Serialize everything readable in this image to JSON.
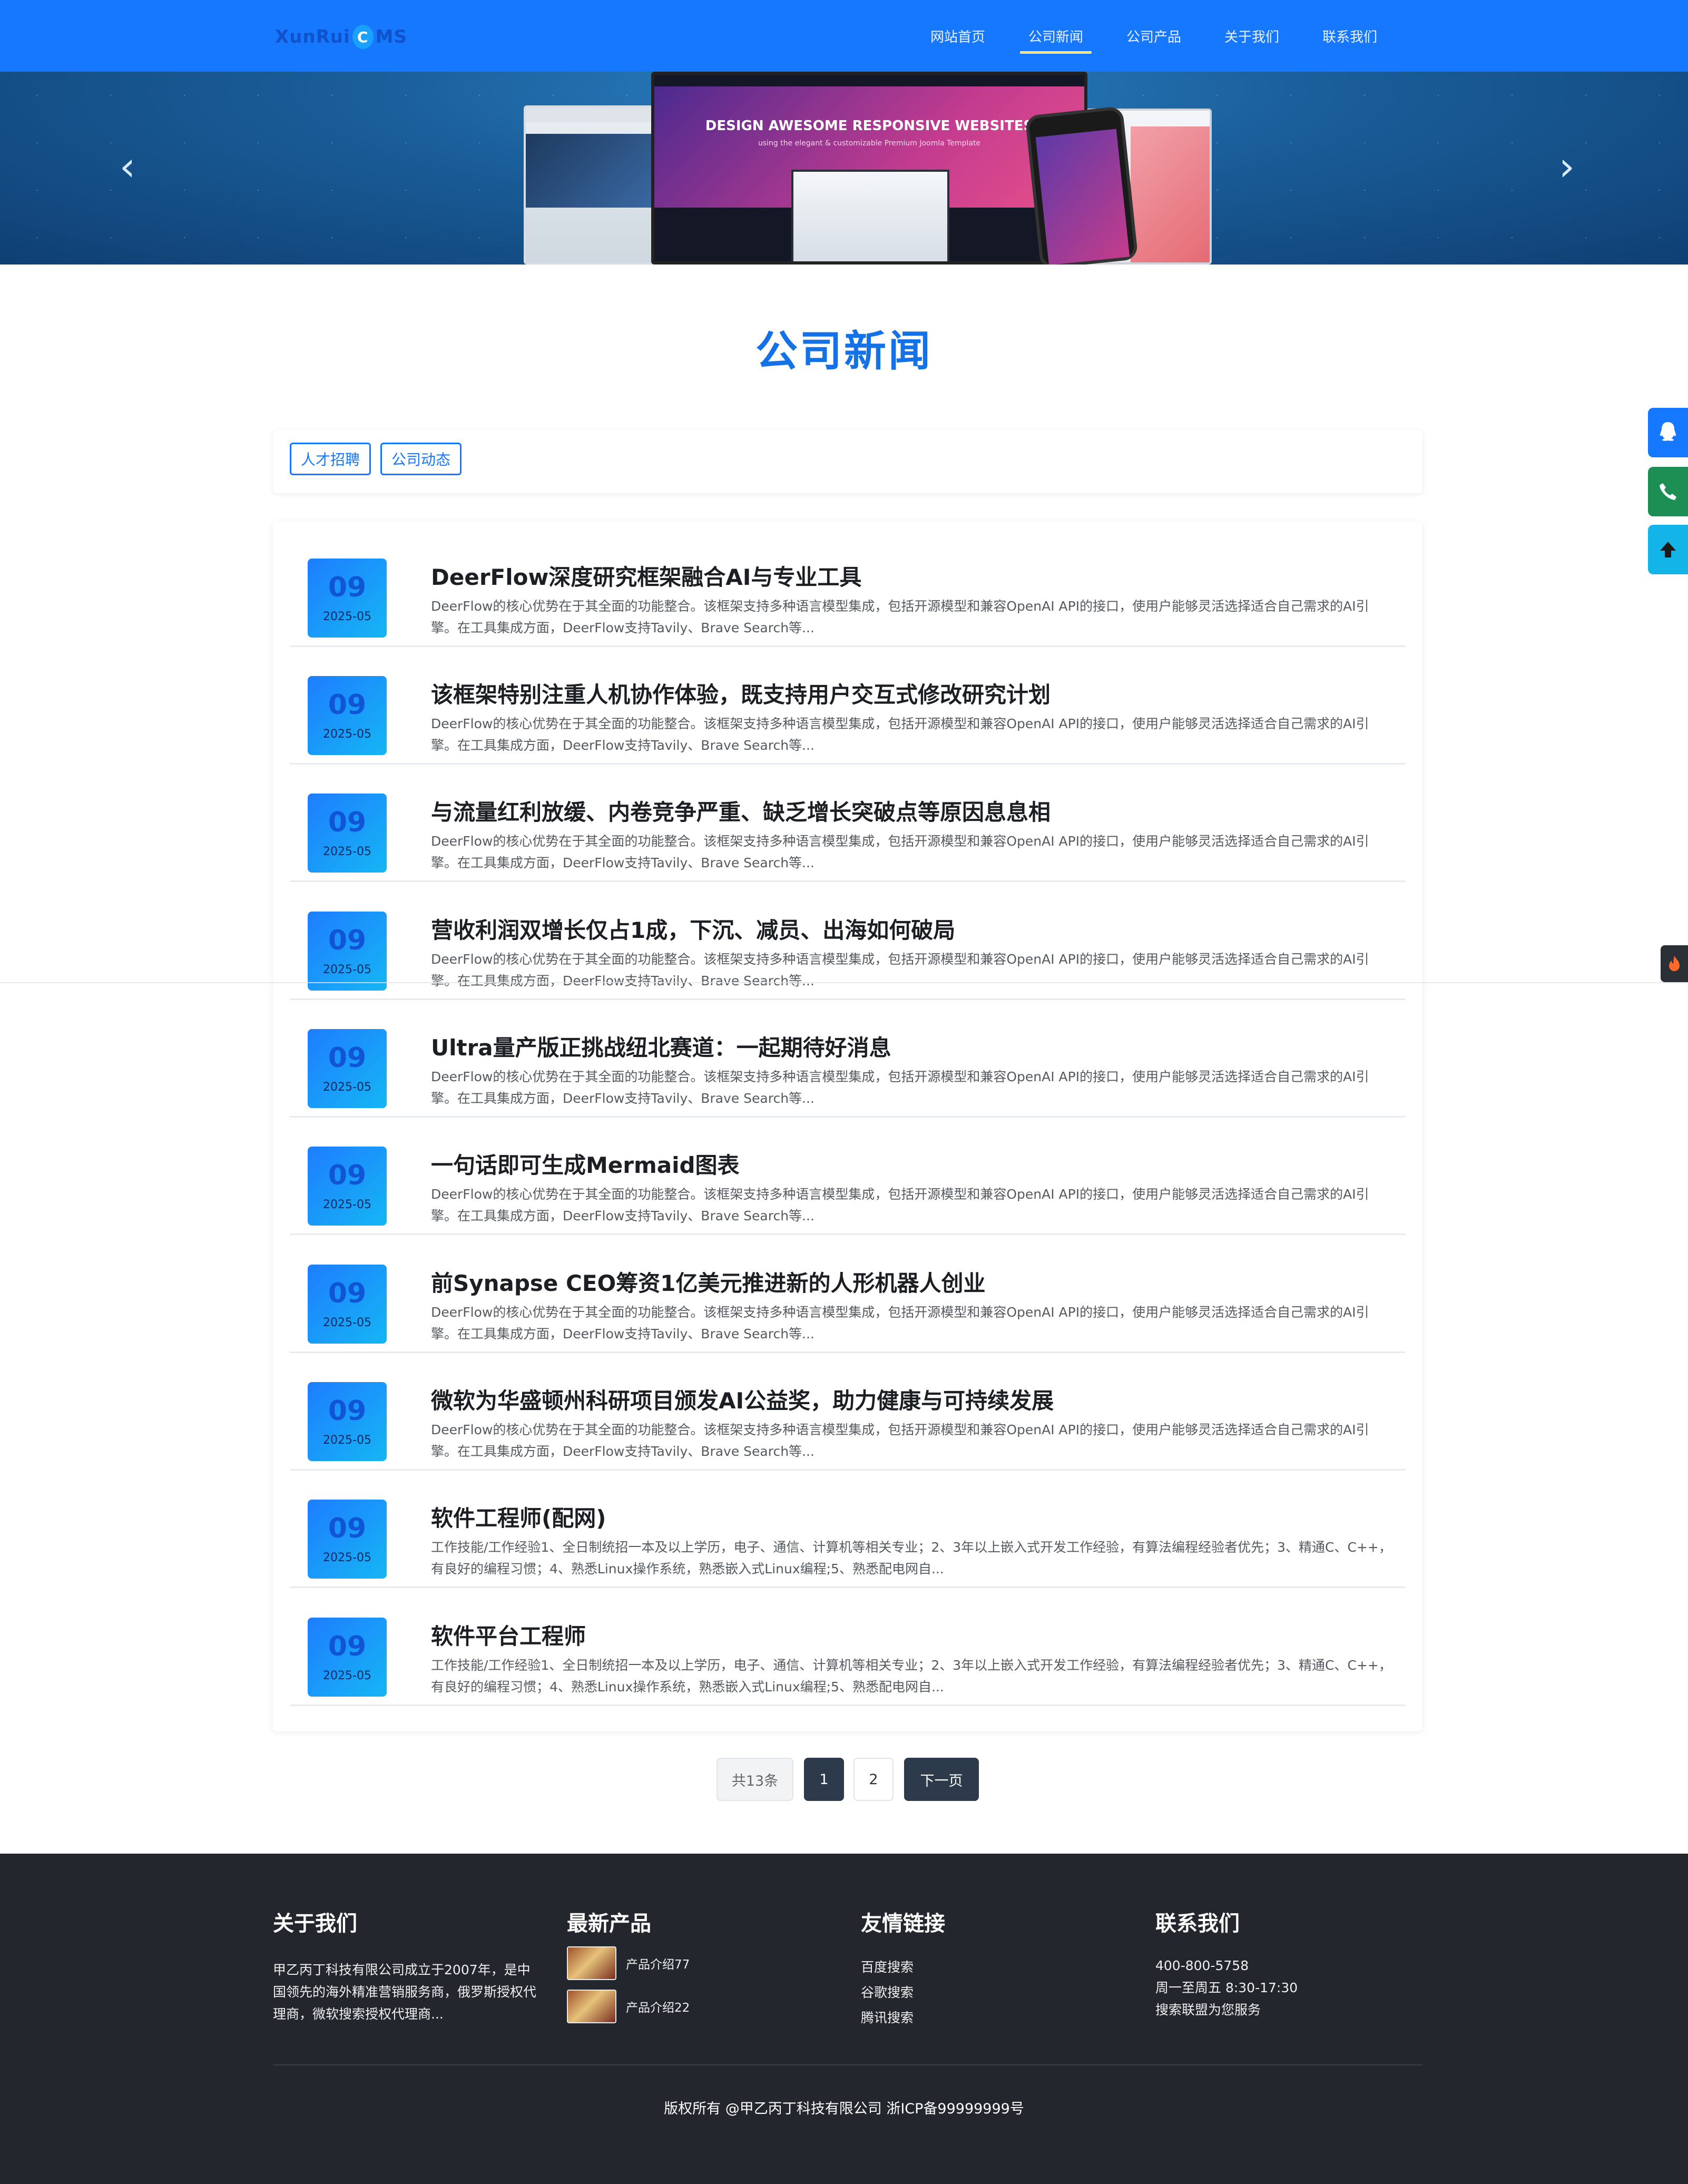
{
  "header": {
    "logo": {
      "text_a": "XunRui",
      "text_c": "C",
      "text_b": "MS"
    },
    "nav": [
      {
        "label": "网站首页",
        "active": false
      },
      {
        "label": "公司新闻",
        "active": true
      },
      {
        "label": "公司产品",
        "active": false
      },
      {
        "label": "关于我们",
        "active": false
      },
      {
        "label": "联系我们",
        "active": false
      }
    ]
  },
  "banner": {
    "prev": "‹",
    "next": "›",
    "mock_title": "DESIGN AWESOME RESPONSIVE WEBSITES",
    "mock_sub": "using the elegant & customizable Premium Joomla Template"
  },
  "page": {
    "title": "公司新闻"
  },
  "categories": [
    "人才招聘",
    "公司动态"
  ],
  "news": [
    {
      "day": "09",
      "ym": "2025-05",
      "title": "DeerFlow深度研究框架融合AI与专业工具",
      "desc": "DeerFlow的核心优势在于其全面的功能整合。该框架支持多种语言模型集成，包括开源模型和兼容OpenAI API的接口，使用户能够灵活选择适合自己需求的AI引擎。在工具集成方面，DeerFlow支持Tavily、Brave Search等..."
    },
    {
      "day": "09",
      "ym": "2025-05",
      "title": "该框架特别注重人机协作体验，既支持用户交互式修改研究计划",
      "desc": "DeerFlow的核心优势在于其全面的功能整合。该框架支持多种语言模型集成，包括开源模型和兼容OpenAI API的接口，使用户能够灵活选择适合自己需求的AI引擎。在工具集成方面，DeerFlow支持Tavily、Brave Search等..."
    },
    {
      "day": "09",
      "ym": "2025-05",
      "title": "与流量红利放缓、内卷竞争严重、缺乏增长突破点等原因息息相",
      "desc": "DeerFlow的核心优势在于其全面的功能整合。该框架支持多种语言模型集成，包括开源模型和兼容OpenAI API的接口，使用户能够灵活选择适合自己需求的AI引擎。在工具集成方面，DeerFlow支持Tavily、Brave Search等..."
    },
    {
      "day": "09",
      "ym": "2025-05",
      "title": "营收利润双增长仅占1成，下沉、减员、出海如何破局",
      "desc": "DeerFlow的核心优势在于其全面的功能整合。该框架支持多种语言模型集成，包括开源模型和兼容OpenAI API的接口，使用户能够灵活选择适合自己需求的AI引擎。在工具集成方面，DeerFlow支持Tavily、Brave Search等..."
    },
    {
      "day": "09",
      "ym": "2025-05",
      "title": "Ultra量产版正挑战纽北赛道：一起期待好消息",
      "desc": "DeerFlow的核心优势在于其全面的功能整合。该框架支持多种语言模型集成，包括开源模型和兼容OpenAI API的接口，使用户能够灵活选择适合自己需求的AI引擎。在工具集成方面，DeerFlow支持Tavily、Brave Search等..."
    },
    {
      "day": "09",
      "ym": "2025-05",
      "title": "一句话即可生成Mermaid图表",
      "desc": "DeerFlow的核心优势在于其全面的功能整合。该框架支持多种语言模型集成，包括开源模型和兼容OpenAI API的接口，使用户能够灵活选择适合自己需求的AI引擎。在工具集成方面，DeerFlow支持Tavily、Brave Search等..."
    },
    {
      "day": "09",
      "ym": "2025-05",
      "title": "前Synapse CEO筹资1亿美元推进新的人形机器人创业",
      "desc": "DeerFlow的核心优势在于其全面的功能整合。该框架支持多种语言模型集成，包括开源模型和兼容OpenAI API的接口，使用户能够灵活选择适合自己需求的AI引擎。在工具集成方面，DeerFlow支持Tavily、Brave Search等..."
    },
    {
      "day": "09",
      "ym": "2025-05",
      "title": "微软为华盛顿州科研项目颁发AI公益奖，助力健康与可持续发展",
      "desc": "DeerFlow的核心优势在于其全面的功能整合。该框架支持多种语言模型集成，包括开源模型和兼容OpenAI API的接口，使用户能够灵活选择适合自己需求的AI引擎。在工具集成方面，DeerFlow支持Tavily、Brave Search等..."
    },
    {
      "day": "09",
      "ym": "2025-05",
      "title": "软件工程师(配网)",
      "desc": "工作技能/工作经验1、全日制统招一本及以上学历，电子、通信、计算机等相关专业；2、3年以上嵌入式开发工作经验，有算法编程经验者优先；3、精通C、C++，有良好的编程习惯；4、熟悉Linux操作系统，熟悉嵌入式Linux编程;5、熟悉配电网自..."
    },
    {
      "day": "09",
      "ym": "2025-05",
      "title": "软件平台工程师",
      "desc": "工作技能/工作经验1、全日制统招一本及以上学历，电子、通信、计算机等相关专业；2、3年以上嵌入式开发工作经验，有算法编程经验者优先；3、精通C、C++，有良好的编程习惯；4、熟悉Linux操作系统，熟悉嵌入式Linux编程;5、熟悉配电网自..."
    }
  ],
  "pagination": {
    "total": "共13条",
    "p1": "1",
    "p2": "2",
    "next": "下一页"
  },
  "footer": {
    "about": {
      "title": "关于我们",
      "text": "甲乙丙丁科技有限公司成立于2007年，是中国领先的海外精准营销服务商，俄罗斯授权代理商，微软搜索授权代理商..."
    },
    "products": {
      "title": "最新产品",
      "items": [
        "产品介绍77",
        "产品介绍22"
      ]
    },
    "links": {
      "title": "友情链接",
      "items": [
        "百度搜索",
        "谷歌搜索",
        "腾讯搜索"
      ]
    },
    "contact": {
      "title": "联系我们",
      "lines": [
        "400-800-5758",
        "周一至周五 8:30-17:30",
        "搜索联盟为您服务"
      ]
    },
    "copyright": "版权所有 @甲乙丙丁科技有限公司 浙ICP备99999999号"
  },
  "widgets": {
    "qq_icon": "qq-icon",
    "phone_icon": "phone-icon",
    "up_icon": "arrow-up-icon",
    "hot_icon": "fire-icon"
  },
  "colors": {
    "primary": "#1677ff",
    "title_blue": "#1472e6",
    "footer_bg": "#23262c",
    "pager_dark": "#2c3a4c"
  }
}
